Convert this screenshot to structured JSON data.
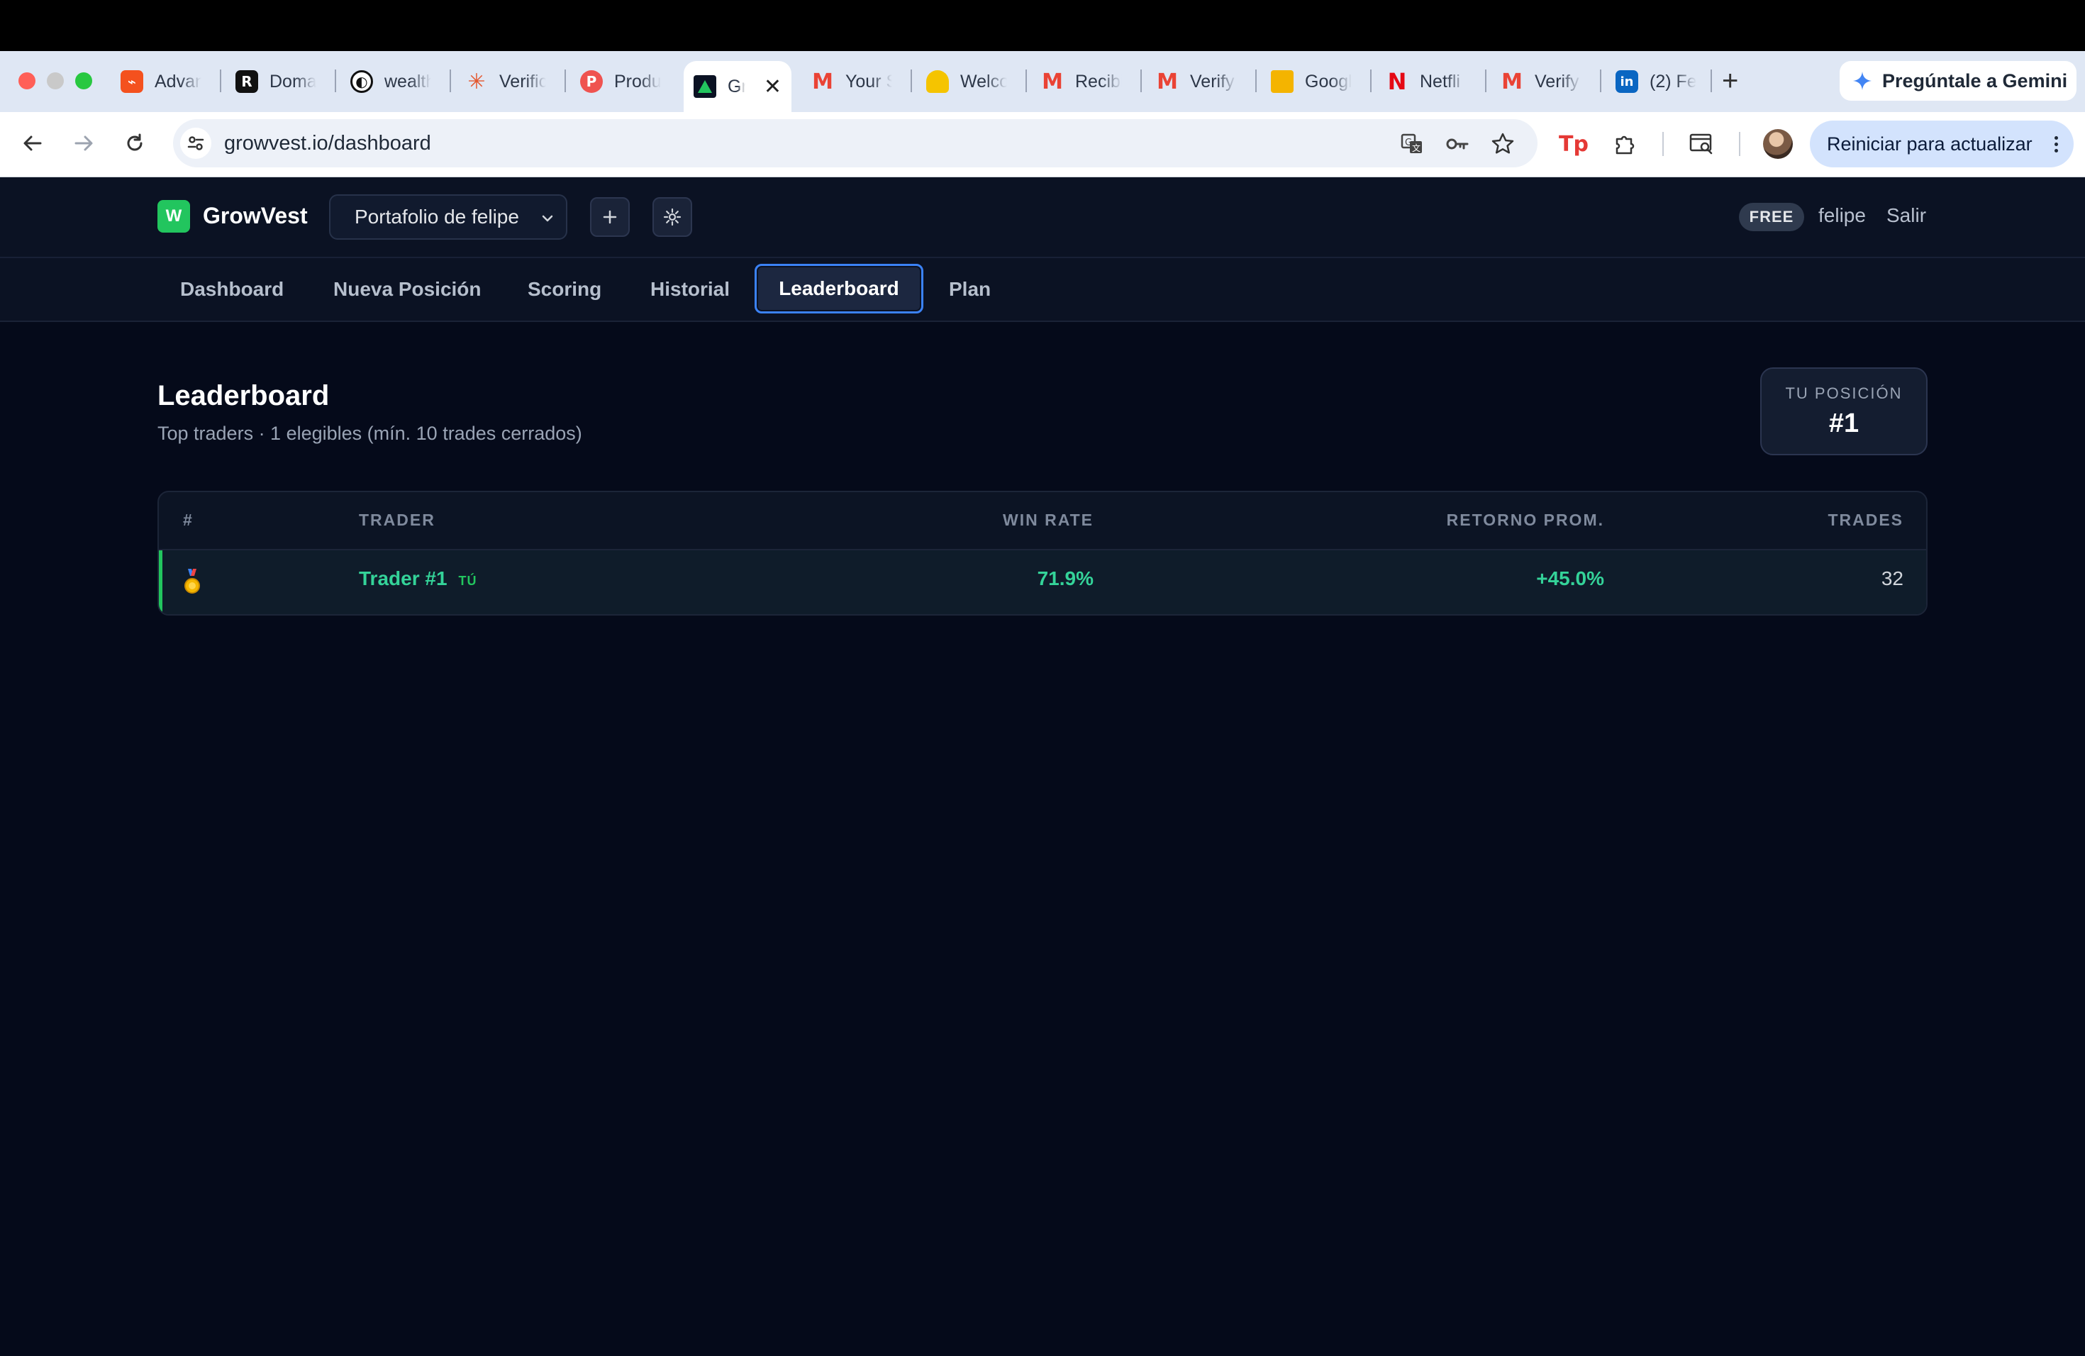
{
  "browser": {
    "tabs": [
      {
        "label": "Advan",
        "favicon_color": "#f4511e",
        "icon": "advan-icon"
      },
      {
        "label": "Doma",
        "favicon_color": "#111111",
        "icon": "domain-icon"
      },
      {
        "label": "wealth",
        "favicon_color": "#111111",
        "icon": "wealth-icon"
      },
      {
        "label": "Verific",
        "favicon_color": "#e4572e",
        "icon": "claude-icon"
      },
      {
        "label": "Produ",
        "favicon_color": "#ef4444",
        "icon": "producthunt-icon"
      },
      {
        "label": "Gr",
        "favicon_color": "#0b1223",
        "icon": "growvest-icon",
        "active": true
      },
      {
        "label": "Your S",
        "favicon_color": "#ea4335",
        "icon": "gmail-icon"
      },
      {
        "label": "Welco",
        "favicon_color": "#f5c400",
        "icon": "welcome-icon"
      },
      {
        "label": "Recibi",
        "favicon_color": "#ea4335",
        "icon": "gmail-icon"
      },
      {
        "label": "Verify",
        "favicon_color": "#ea4335",
        "icon": "gmail-icon"
      },
      {
        "label": "Googl",
        "favicon_color": "#f4b400",
        "icon": "google-meet-icon"
      },
      {
        "label": "Netfli",
        "favicon_color": "#e50914",
        "icon": "netflix-icon"
      },
      {
        "label": "Verify",
        "favicon_color": "#ea4335",
        "icon": "gmail-icon"
      },
      {
        "label": "(2) Fe",
        "favicon_color": "#0a66c2",
        "icon": "linkedin-icon"
      }
    ],
    "gemini_button": "Pregúntale a Gemini",
    "url": "growvest.io/dashboard",
    "update_button": "Reiniciar para actualizar"
  },
  "app": {
    "logo_letter": "W",
    "brand": "GrowVest",
    "portfolio_select": "Portafolio de felipe",
    "plan_badge": "FREE",
    "user": "felipe",
    "logout": "Salir",
    "accent": "#22c55e"
  },
  "nav": {
    "items": [
      "Dashboard",
      "Nueva Posición",
      "Scoring",
      "Historial",
      "Leaderboard",
      "Plan"
    ],
    "active": "Leaderboard"
  },
  "main": {
    "title": "Leaderboard",
    "subtitle": "Top traders · 1 elegibles (mín. 10 trades cerrados)",
    "position_card": {
      "label": "TU POSICIÓN",
      "value": "#1"
    },
    "table": {
      "headers": [
        "#",
        "TRADER",
        "WIN RATE",
        "RETORNO PROM.",
        "TRADES"
      ],
      "rows": [
        {
          "rank_icon": "gold-medal-icon",
          "trader": "Trader #1",
          "you_badge": "TÚ",
          "win_rate": "71.9%",
          "avg_return": "+45.0%",
          "trades": "32"
        }
      ]
    }
  }
}
